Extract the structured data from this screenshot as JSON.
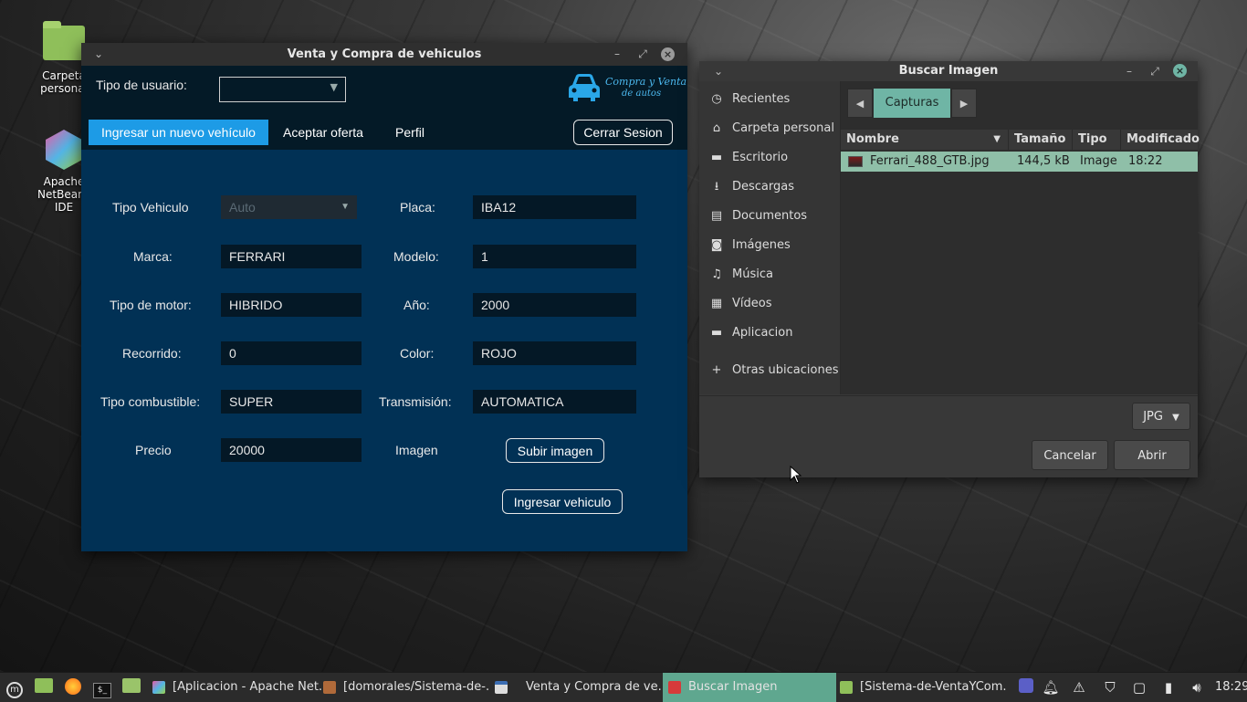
{
  "desktop": {
    "icons": [
      {
        "label_line1": "Carpeta",
        "label_line2": "personal"
      },
      {
        "label_line1": "Apache",
        "label_line2": "NetBeans IDE"
      }
    ]
  },
  "main_window": {
    "title": "Venta y Compra de vehiculos",
    "user_type_label": "Tipo de usuario:",
    "user_type_value": "",
    "logo_line1": "Compra y Venta",
    "logo_line2": "de autos",
    "tabs": [
      {
        "label": "Ingresar un nuevo vehículo",
        "active": true
      },
      {
        "label": "Aceptar oferta",
        "active": false
      },
      {
        "label": "Perfil",
        "active": false
      }
    ],
    "logout_label": "Cerrar Sesion",
    "form": {
      "tipo_vehiculo_label": "Tipo Vehiculo",
      "tipo_vehiculo_value": "Auto",
      "placa_label": "Placa:",
      "placa_value": "IBA12",
      "marca_label": "Marca:",
      "marca_value": "FERRARI",
      "modelo_label": "Modelo:",
      "modelo_value": "1",
      "motor_label": "Tipo de motor:",
      "motor_value": "HIBRIDO",
      "anio_label": "Año:",
      "anio_value": "2000",
      "recorrido_label": "Recorrido:",
      "recorrido_value": "0",
      "color_label": "Color:",
      "color_value": "ROJO",
      "combustible_label": "Tipo combustible:",
      "combustible_value": "SUPER",
      "transmision_label": "Transmisión:",
      "transmision_value": "AUTOMATICA",
      "precio_label": "Precio",
      "precio_value": "20000",
      "imagen_label": "Imagen",
      "upload_label": "Subir imagen",
      "submit_label": "Ingresar vehiculo"
    }
  },
  "file_dialog": {
    "title": "Buscar Imagen",
    "places": [
      {
        "label": "Recientes",
        "icon": "clock-icon",
        "glyph": "◷"
      },
      {
        "label": "Carpeta personal",
        "icon": "home-icon",
        "glyph": "⌂"
      },
      {
        "label": "Escritorio",
        "icon": "desktop-folder-icon",
        "glyph": "▬"
      },
      {
        "label": "Descargas",
        "icon": "download-icon",
        "glyph": "⭳"
      },
      {
        "label": "Documentos",
        "icon": "document-icon",
        "glyph": "▤"
      },
      {
        "label": "Imágenes",
        "icon": "camera-icon",
        "glyph": "◙"
      },
      {
        "label": "Música",
        "icon": "music-icon",
        "glyph": "♫"
      },
      {
        "label": "Vídeos",
        "icon": "film-icon",
        "glyph": "▦"
      },
      {
        "label": "Aplicacion",
        "icon": "folder-icon",
        "glyph": "▬"
      },
      {
        "label": "Otras ubicaciones",
        "icon": "plus-icon",
        "glyph": "+"
      }
    ],
    "breadcrumb": "Capturas",
    "columns": {
      "name": "Nombre",
      "size": "Tamaño",
      "type": "Tipo",
      "modified": "Modificado"
    },
    "file": {
      "name": "Ferrari_488_GTB.jpg",
      "size": "144,5 kB",
      "type": "Image",
      "modified": "18:22"
    },
    "filter": "JPG",
    "cancel_label": "Cancelar",
    "open_label": "Abrir"
  },
  "taskbar": {
    "tasks": [
      {
        "label": "[Aplicacion - Apache Net..."
      },
      {
        "label": "[domorales/Sistema-de-..."
      },
      {
        "label": "Venta y Compra de ve..."
      },
      {
        "label": "Buscar Imagen"
      },
      {
        "label": "[Sistema-de-VentaYCom..."
      }
    ],
    "clock": "18:29",
    "terminal_glyph": "$_"
  }
}
